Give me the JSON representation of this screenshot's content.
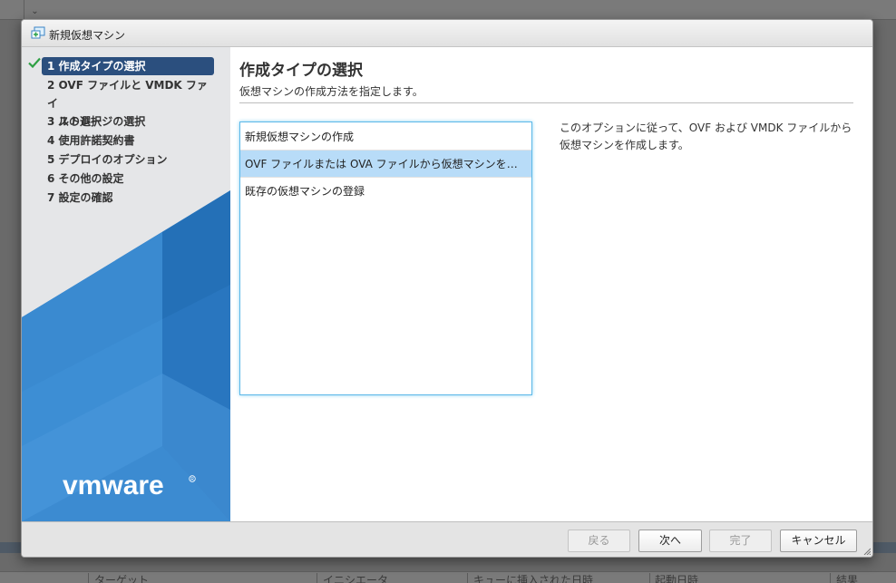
{
  "dialog": {
    "title": "新規仮想マシン"
  },
  "nav": {
    "steps": [
      {
        "label": "1 作成タイプの選択"
      },
      {
        "label_line1": "2 OVF ファイルと VMDK ファイ",
        "label_line2": "ルの選択"
      },
      {
        "label": "3 ストレージの選択"
      },
      {
        "label": "4 使用許諾契約書"
      },
      {
        "label": "5 デプロイのオプション"
      },
      {
        "label": "6 その他の設定"
      },
      {
        "label": "7 設定の確認"
      }
    ],
    "logo_text": "vmware"
  },
  "main": {
    "title": "作成タイプの選択",
    "subtitle": "仮想マシンの作成方法を指定します。",
    "options": [
      {
        "label": "新規仮想マシンの作成"
      },
      {
        "label": "OVF ファイルまたは OVA ファイルから仮想マシンをデプロイ"
      },
      {
        "label": "既存の仮想マシンの登録"
      }
    ],
    "description_line1": "このオプションに従って、OVF および VMDK ファイルから",
    "description_line2": "仮想マシンを作成します。"
  },
  "footer": {
    "back_label": "戻る",
    "next_label": "次へ",
    "finish_label": "完了",
    "cancel_label": "キャンセル"
  },
  "background": {
    "columns": [
      "ターゲット",
      "イニシエータ",
      "キューに挿入された日時",
      "起動日時",
      "結果"
    ]
  },
  "colors": {
    "nav_active": "#2b4f7e",
    "selected_row": "#b8dcf8",
    "listbox_border": "#5bb8e8",
    "vmware_blue": "#2d7bc4"
  }
}
